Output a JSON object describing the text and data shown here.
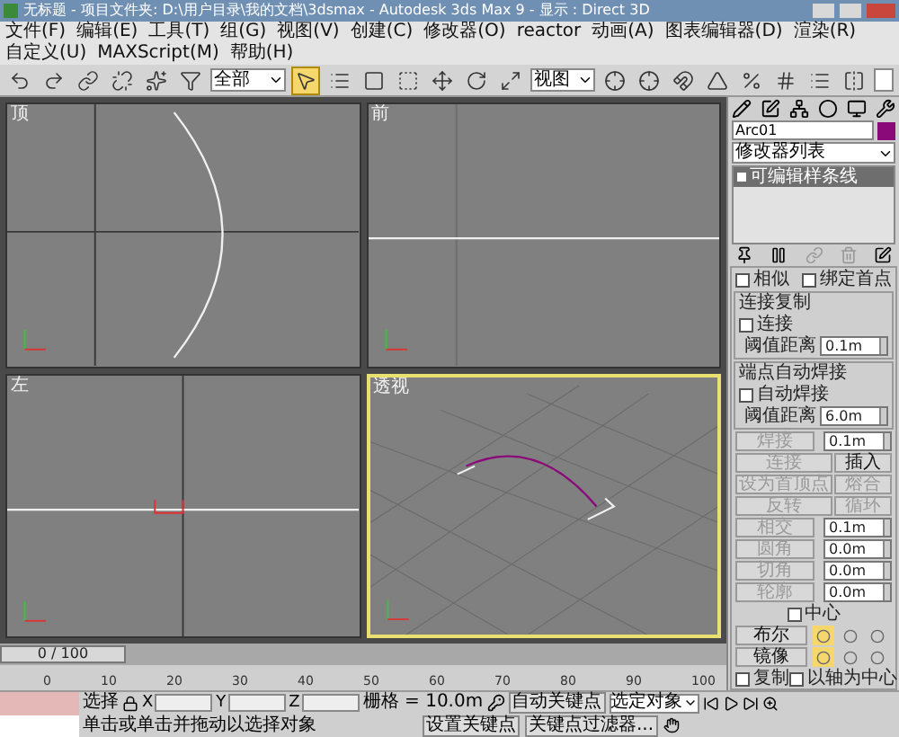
{
  "window": {
    "title": "无标题 - 项目文件夹: D:\\用户目录\\我的文档\\3dsmax - Autodesk 3ds Max 9 - 显示 : Direct 3D"
  },
  "menu": [
    "文件(F)",
    "编辑(E)",
    "工具(T)",
    "组(G)",
    "视图(V)",
    "创建(C)",
    "修改器(O)",
    "reactor",
    "动画(A)",
    "图表编辑器(D)",
    "渲染(R)",
    "自定义(U)",
    "MAXScript(M)",
    "帮助(H)"
  ],
  "toolbar": {
    "selection_filter": "全部",
    "coord_system": "视图",
    "tools": [
      {
        "kind": "undo",
        "selected": false
      },
      {
        "kind": "redo",
        "selected": false
      },
      {
        "kind": "link",
        "selected": false
      },
      {
        "kind": "unlink",
        "selected": false
      },
      {
        "kind": "bind",
        "selected": false
      },
      {
        "kind": "filter",
        "selected": false
      },
      {
        "kind": "select",
        "selected": true
      },
      {
        "kind": "select_name",
        "selected": false
      },
      {
        "kind": "region",
        "selected": false
      },
      {
        "kind": "crossing",
        "selected": false
      },
      {
        "kind": "move",
        "selected": false
      },
      {
        "kind": "rotate",
        "selected": false
      },
      {
        "kind": "scale",
        "selected": false
      },
      {
        "kind": "coord",
        "selected": false
      },
      {
        "kind": "pivot",
        "selected": false
      },
      {
        "kind": "snap",
        "selected": false
      },
      {
        "kind": "angle_snap",
        "selected": false
      },
      {
        "kind": "percent_snap",
        "selected": false
      },
      {
        "kind": "spinner_snap",
        "selected": false
      },
      {
        "kind": "named_sets",
        "selected": false
      },
      {
        "kind": "mirror",
        "selected": false
      }
    ]
  },
  "viewports": [
    {
      "kind": "top",
      "label": "顶",
      "selected": false
    },
    {
      "kind": "front",
      "label": "前",
      "selected": false
    },
    {
      "kind": "left",
      "label": "左",
      "selected": false
    },
    {
      "kind": "perspective",
      "label": "透视",
      "selected": true
    }
  ],
  "time_slider": {
    "label": "0 / 100",
    "level": 0
  },
  "ruler": [
    "0",
    "10",
    "20",
    "30",
    "40",
    "50",
    "60",
    "70",
    "80",
    "90",
    "100"
  ],
  "command_panel": {
    "object": {
      "name": "Arc01",
      "color": "#8b0a7a"
    },
    "modifier_list": "修改器列表",
    "stack": [
      {
        "label": "可编辑样条线",
        "selected": true
      }
    ],
    "rollout": [
      {
        "kind": "checkbox_pair",
        "items": [
          {
            "label": "相似",
            "checked": false
          },
          {
            "label": "绑定首点",
            "checked": false
          }
        ]
      },
      {
        "kind": "group",
        "title": "连接复制",
        "rows": [
          {
            "kind": "checkbox",
            "label": "连接",
            "checked": false
          },
          {
            "kind": "spinner",
            "label": "阈值距离",
            "value": "0.1m"
          }
        ]
      },
      {
        "kind": "group",
        "title": "端点自动焊接",
        "rows": [
          {
            "kind": "checkbox",
            "label": "自动焊接",
            "checked": false
          },
          {
            "kind": "spinner",
            "label": "阈值距离",
            "value": "6.0m"
          }
        ]
      },
      {
        "kind": "button_spinner",
        "label": "焊接",
        "value": "0.1m",
        "disabled": true
      },
      {
        "kind": "button_pair",
        "items": [
          {
            "label": "连接",
            "disabled": true
          },
          {
            "label": "插入",
            "disabled": false
          }
        ]
      },
      {
        "kind": "button_pair",
        "items": [
          {
            "label": "设为首顶点",
            "disabled": true
          },
          {
            "label": "熔合",
            "disabled": true
          }
        ]
      },
      {
        "kind": "button_pair",
        "items": [
          {
            "label": "反转",
            "disabled": true
          },
          {
            "label": "循环",
            "disabled": true
          }
        ]
      },
      {
        "kind": "button_spinner",
        "label": "相交",
        "value": "0.1m",
        "disabled": true
      },
      {
        "kind": "button_spinner",
        "label": "圆角",
        "value": "0.0m",
        "disabled": true
      },
      {
        "kind": "button_spinner",
        "label": "切角",
        "value": "0.0m",
        "disabled": true
      },
      {
        "kind": "button_spinner",
        "label": "轮廓",
        "value": "0.0m",
        "disabled": true
      },
      {
        "kind": "checkbox_indent",
        "label": "中心",
        "checked": false
      },
      {
        "kind": "button_icons",
        "label": "布尔",
        "disabled": false,
        "icons": [
          {
            "selected": true
          },
          {
            "selected": false
          },
          {
            "selected": false
          }
        ]
      },
      {
        "kind": "button_icons",
        "label": "镜像",
        "disabled": false,
        "icons": [
          {
            "selected": true
          },
          {
            "selected": false
          },
          {
            "selected": false
          }
        ]
      },
      {
        "kind": "checkbox_pair",
        "items": [
          {
            "label": "复制",
            "checked": false
          },
          {
            "label": "以轴为中心",
            "checked": false
          }
        ]
      }
    ]
  },
  "status_bar": {
    "selection_label": "选择",
    "axes": [
      "X",
      "Y",
      "Z"
    ],
    "grid": "栅格 = 10.0m",
    "auto_key": "自动关键点",
    "key_mode": "选定对象",
    "set_key": "设置关键点",
    "key_filters": "关键点过滤器...",
    "prompt": "单击或单击并拖动以选择对象"
  }
}
